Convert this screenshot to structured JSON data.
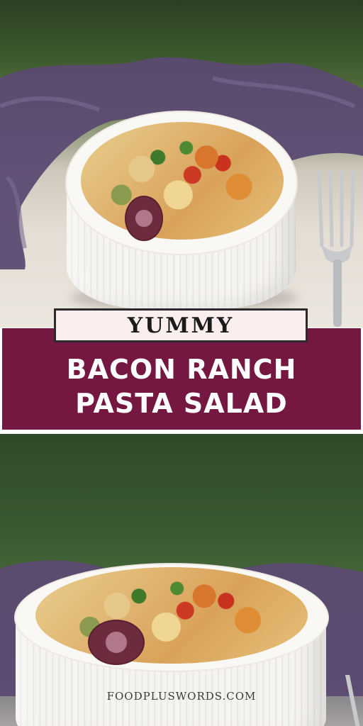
{
  "pin": {
    "badge_text": "YUMMY",
    "title_line_1": "BACON RANCH",
    "title_line_2": "PASTA SALAD",
    "website": "FOODPLUSWORDS.COM"
  },
  "colors": {
    "badge_background": "#fbeeee",
    "title_band": "#741841",
    "title_text": "#ffffff",
    "cloth": "#5c4a72"
  },
  "images": {
    "top_photo": "pasta-salad-bowl-top-photo",
    "bottom_photo": "pasta-salad-bowl-closeup-photo"
  }
}
